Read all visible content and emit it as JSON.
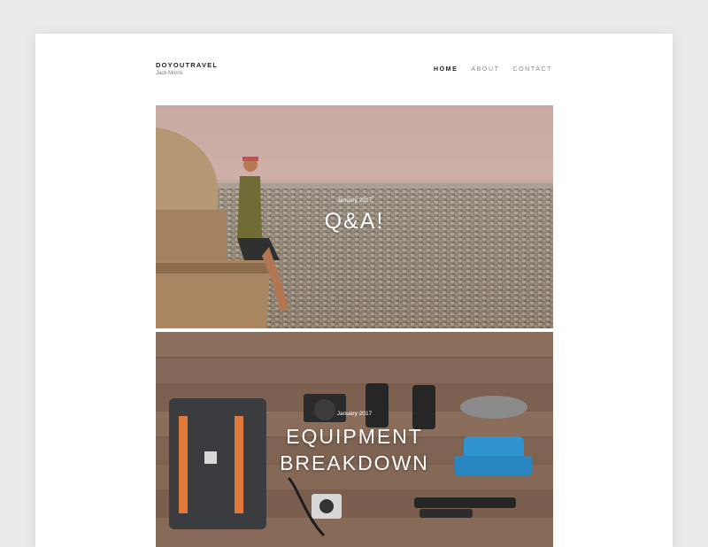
{
  "site": {
    "title": "DOYOUTRAVEL",
    "subtitle": "Jack Morris"
  },
  "nav": {
    "items": [
      "HOME",
      "ABOUT",
      "CONTACT"
    ],
    "active": "HOME"
  },
  "posts": [
    {
      "date": "January 2017",
      "title": "Q&A!"
    },
    {
      "date": "January 2017",
      "title_line1": "EQUIPMENT",
      "title_line2": "BREAKDOWN"
    }
  ],
  "colors": {
    "page": "#ffffff",
    "background": "#ebebeb",
    "text": "#222222",
    "muted": "#8a8a8a",
    "overlay_text": "#ffffff"
  }
}
